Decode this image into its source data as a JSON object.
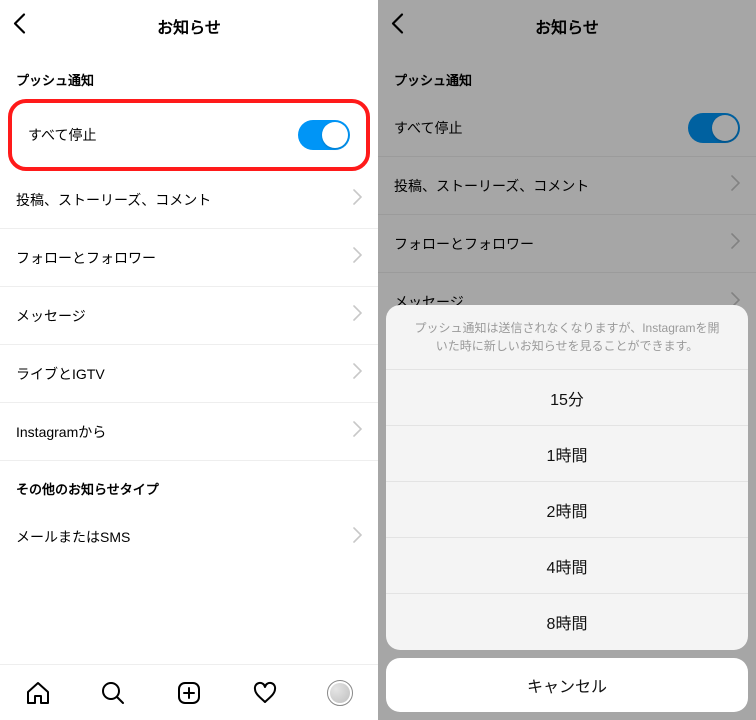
{
  "left": {
    "header": {
      "title": "お知らせ"
    },
    "section1": "プッシュ通知",
    "pause_all": "すべて停止",
    "rows": [
      "投稿、ストーリーズ、コメント",
      "フォローとフォロワー",
      "メッセージ",
      "ライブとIGTV",
      "Instagramから"
    ],
    "section2": "その他のお知らせタイプ",
    "rows2": [
      "メールまたはSMS"
    ]
  },
  "right": {
    "header": {
      "title": "お知らせ"
    },
    "section1": "プッシュ通知",
    "pause_all": "すべて停止",
    "rows": [
      "投稿、ストーリーズ、コメント",
      "フォローとフォロワー",
      "メッセージ"
    ],
    "sheet": {
      "message": "プッシュ通知は送信されなくなりますが、Instagramを開いた時に新しいお知らせを見ることができます。",
      "options": [
        "15分",
        "1時間",
        "2時間",
        "4時間",
        "8時間"
      ],
      "cancel": "キャンセル"
    }
  },
  "colors": {
    "accent": "#0095f6",
    "highlight": "#ff1a1a"
  }
}
